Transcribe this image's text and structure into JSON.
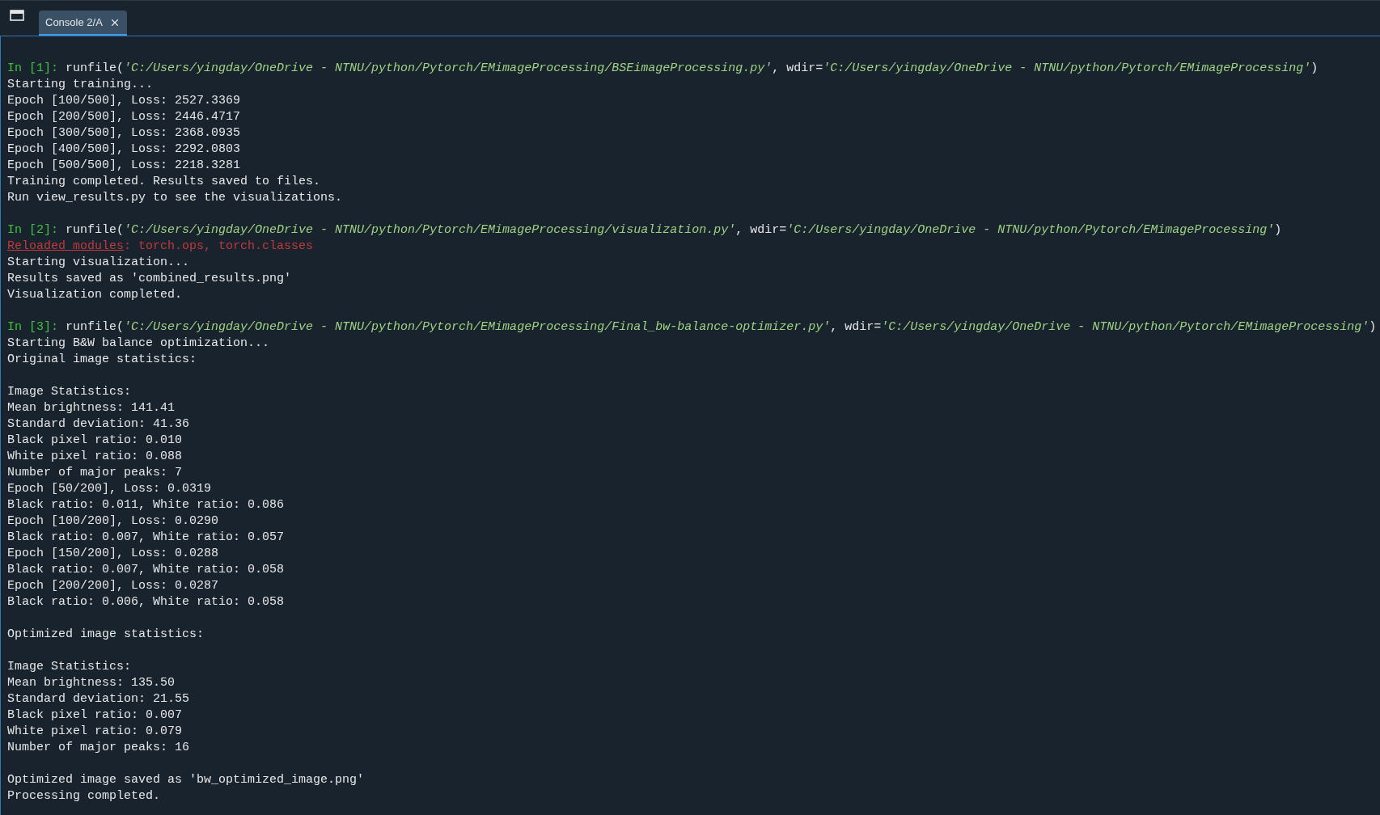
{
  "tabs": [
    {
      "label": "Console 2/A",
      "selected": true
    }
  ],
  "console": {
    "lines": [
      {
        "kind": "prompt",
        "prompt": "In [1]:",
        "segments": [
          {
            "kind": "code",
            "text": "runfile("
          },
          {
            "kind": "string",
            "text": "'C:/Users/yingday/OneDrive - NTNU/python/Pytorch/EMimageProcessing/BSEimageProcessing.py'"
          },
          {
            "kind": "code",
            "text": ", wdir="
          },
          {
            "kind": "string",
            "text": "'C:/Users/yingday/OneDrive - NTNU/python/Pytorch/EMimageProcessing'"
          },
          {
            "kind": "code",
            "text": ")"
          }
        ]
      },
      {
        "kind": "output",
        "text": "Starting training..."
      },
      {
        "kind": "output",
        "text": "Epoch [100/500], Loss: 2527.3369"
      },
      {
        "kind": "output",
        "text": "Epoch [200/500], Loss: 2446.4717"
      },
      {
        "kind": "output",
        "text": "Epoch [300/500], Loss: 2368.0935"
      },
      {
        "kind": "output",
        "text": "Epoch [400/500], Loss: 2292.0803"
      },
      {
        "kind": "output",
        "text": "Epoch [500/500], Loss: 2218.3281"
      },
      {
        "kind": "output",
        "text": "Training completed. Results saved to files."
      },
      {
        "kind": "output",
        "text": "Run view_results.py to see the visualizations."
      },
      {
        "kind": "blank"
      },
      {
        "kind": "prompt",
        "prompt": "In [2]:",
        "segments": [
          {
            "kind": "code",
            "text": "runfile("
          },
          {
            "kind": "string",
            "text": "'C:/Users/yingday/OneDrive - NTNU/python/Pytorch/EMimageProcessing/visualization.py'"
          },
          {
            "kind": "code",
            "text": ", wdir="
          },
          {
            "kind": "string",
            "text": "'C:/Users/yingday/OneDrive - NTNU/python/Pytorch/EMimageProcessing'"
          },
          {
            "kind": "code",
            "text": ")"
          }
        ]
      },
      {
        "kind": "error",
        "link": "Reloaded modules",
        "text": ": torch.ops, torch.classes"
      },
      {
        "kind": "output",
        "text": "Starting visualization..."
      },
      {
        "kind": "output",
        "text": "Results saved as 'combined_results.png'"
      },
      {
        "kind": "output",
        "text": "Visualization completed."
      },
      {
        "kind": "blank"
      },
      {
        "kind": "prompt",
        "prompt": "In [3]:",
        "segments": [
          {
            "kind": "code",
            "text": "runfile("
          },
          {
            "kind": "string",
            "text": "'C:/Users/yingday/OneDrive - NTNU/python/Pytorch/EMimageProcessing/Final_bw-balance-optimizer.py'"
          },
          {
            "kind": "code",
            "text": ", wdir="
          },
          {
            "kind": "string",
            "text": "'C:/Users/yingday/OneDrive - NTNU/python/Pytorch/EMimageProcessing'"
          },
          {
            "kind": "code",
            "text": ")"
          }
        ]
      },
      {
        "kind": "output",
        "text": "Starting B&W balance optimization..."
      },
      {
        "kind": "output",
        "text": "Original image statistics:"
      },
      {
        "kind": "blank"
      },
      {
        "kind": "output",
        "text": "Image Statistics:"
      },
      {
        "kind": "output",
        "text": "Mean brightness: 141.41"
      },
      {
        "kind": "output",
        "text": "Standard deviation: 41.36"
      },
      {
        "kind": "output",
        "text": "Black pixel ratio: 0.010"
      },
      {
        "kind": "output",
        "text": "White pixel ratio: 0.088"
      },
      {
        "kind": "output",
        "text": "Number of major peaks: 7"
      },
      {
        "kind": "output",
        "text": "Epoch [50/200], Loss: 0.0319"
      },
      {
        "kind": "output",
        "text": "Black ratio: 0.011, White ratio: 0.086"
      },
      {
        "kind": "output",
        "text": "Epoch [100/200], Loss: 0.0290"
      },
      {
        "kind": "output",
        "text": "Black ratio: 0.007, White ratio: 0.057"
      },
      {
        "kind": "output",
        "text": "Epoch [150/200], Loss: 0.0288"
      },
      {
        "kind": "output",
        "text": "Black ratio: 0.007, White ratio: 0.058"
      },
      {
        "kind": "output",
        "text": "Epoch [200/200], Loss: 0.0287"
      },
      {
        "kind": "output",
        "text": "Black ratio: 0.006, White ratio: 0.058"
      },
      {
        "kind": "blank"
      },
      {
        "kind": "output",
        "text": "Optimized image statistics:"
      },
      {
        "kind": "blank"
      },
      {
        "kind": "output",
        "text": "Image Statistics:"
      },
      {
        "kind": "output",
        "text": "Mean brightness: 135.50"
      },
      {
        "kind": "output",
        "text": "Standard deviation: 21.55"
      },
      {
        "kind": "output",
        "text": "Black pixel ratio: 0.007"
      },
      {
        "kind": "output",
        "text": "White pixel ratio: 0.079"
      },
      {
        "kind": "output",
        "text": "Number of major peaks: 16"
      },
      {
        "kind": "blank"
      },
      {
        "kind": "output",
        "text": "Optimized image saved as 'bw_optimized_image.png'"
      },
      {
        "kind": "output",
        "text": "Processing completed."
      }
    ]
  }
}
